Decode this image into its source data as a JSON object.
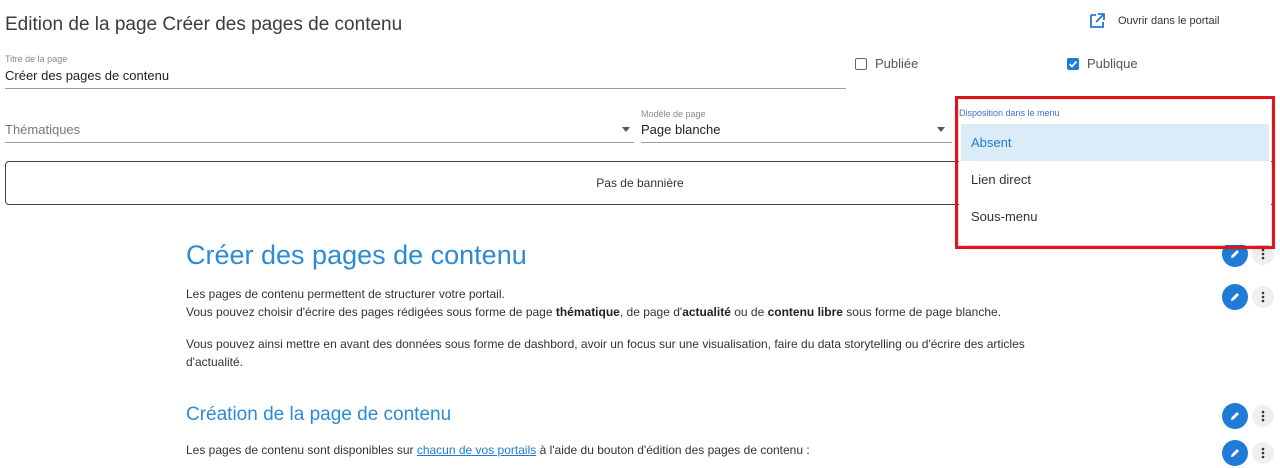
{
  "header": {
    "title": "Edition de la page Créer des pages de contenu",
    "open_portal_label": "Ouvrir dans le portail",
    "open_portal_icon": "external-link-icon"
  },
  "form": {
    "title_field": {
      "label": "Titre de la page",
      "value": "Créer des pages de contenu"
    },
    "published": {
      "label": "Publiée",
      "checked": false
    },
    "public": {
      "label": "Publique",
      "checked": true
    },
    "thematics": {
      "placeholder": "Thématiques"
    },
    "template": {
      "label": "Modèle de page",
      "value": "Page blanche"
    },
    "menu_position": {
      "label": "Disposition dans le menu",
      "options": [
        {
          "label": "Absent",
          "selected": true
        },
        {
          "label": "Lien direct",
          "selected": false
        },
        {
          "label": "Sous-menu",
          "selected": false
        }
      ]
    },
    "banner_button": "Pas de bannière"
  },
  "content": {
    "h1": "Créer des pages de contenu",
    "p1_line1": "Les pages de contenu permettent de structurer votre portail.",
    "p1_line2": {
      "t1": "Vous pouvez choisir d'écrire des pages rédigées sous forme de page ",
      "b1": "thématique",
      "t2": ", de page d'",
      "b2": "actualité",
      "t3": " ou de ",
      "b3": "contenu libre",
      "t4": " sous forme de page blanche."
    },
    "p2_line1": "Vous pouvez ainsi mettre en avant des données sous forme de dashbord, avoir un focus sur une visualisation, faire du data storytelling ou d'écrire des articles",
    "p2_line2": "d'actualité.",
    "h2": "Création de la page de contenu",
    "p3": {
      "t1": "Les pages de contenu sont disponibles sur ",
      "link": "chacun de vos portails",
      "t2": " à l'aide du bouton d'édition des pages de contenu :"
    }
  },
  "colors": {
    "accent": "#1e7bd6",
    "heading": "#2d8bd6",
    "highlight_box": "#e0141b",
    "selected_option_bg": "#dcebf8"
  }
}
